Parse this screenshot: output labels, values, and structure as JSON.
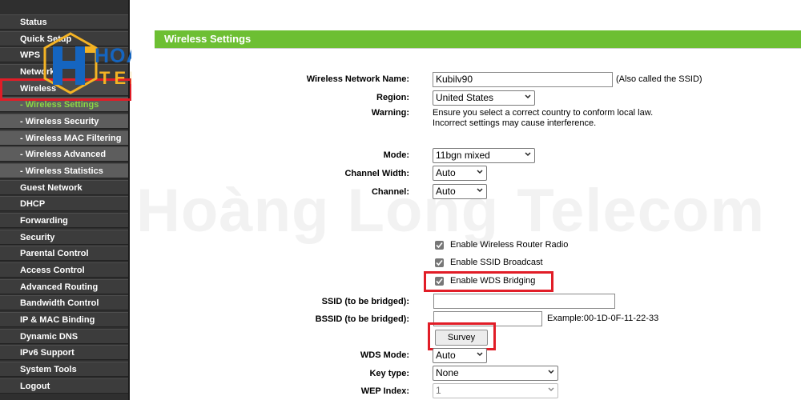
{
  "sidebar": {
    "items": [
      {
        "label": "Status"
      },
      {
        "label": "Quick Setup"
      },
      {
        "label": "WPS"
      },
      {
        "label": "Network"
      },
      {
        "label": "Wireless"
      },
      {
        "label": "- Wireless Settings"
      },
      {
        "label": "- Wireless Security"
      },
      {
        "label": "- Wireless MAC Filtering"
      },
      {
        "label": "- Wireless Advanced"
      },
      {
        "label": "- Wireless Statistics"
      },
      {
        "label": "Guest Network"
      },
      {
        "label": "DHCP"
      },
      {
        "label": "Forwarding"
      },
      {
        "label": "Security"
      },
      {
        "label": "Parental Control"
      },
      {
        "label": "Access Control"
      },
      {
        "label": "Advanced Routing"
      },
      {
        "label": "Bandwidth Control"
      },
      {
        "label": "IP & MAC Binding"
      },
      {
        "label": "Dynamic DNS"
      },
      {
        "label": "IPv6 Support"
      },
      {
        "label": "System Tools"
      },
      {
        "label": "Logout"
      }
    ]
  },
  "logo": {
    "line1": "HOANG LONG",
    "line2": "TELECOM"
  },
  "watermark": "Hoàng Long Telecom",
  "page": {
    "title": "Wireless Settings"
  },
  "form": {
    "network_name_label": "Wireless Network Name:",
    "network_name_value": "Kubilv90",
    "network_name_hint": "(Also called the SSID)",
    "region_label": "Region:",
    "region_value": "United States",
    "warning_label": "Warning:",
    "warning_line1": "Ensure you select a correct country to conform local law.",
    "warning_line2": "Incorrect settings may cause interference.",
    "mode_label": "Mode:",
    "mode_value": "11bgn mixed",
    "channel_width_label": "Channel Width:",
    "channel_width_value": "Auto",
    "channel_label": "Channel:",
    "channel_value": "Auto",
    "enable_radio_label": "Enable Wireless Router Radio",
    "enable_ssid_broadcast_label": "Enable SSID Broadcast",
    "enable_wds_label": "Enable WDS Bridging",
    "ssid_bridged_label": "SSID (to be bridged):",
    "ssid_bridged_value": "",
    "bssid_bridged_label": "BSSID (to be bridged):",
    "bssid_bridged_value": "",
    "bssid_example": "Example:00-1D-0F-11-22-33",
    "survey_label": "Survey",
    "wds_mode_label": "WDS Mode:",
    "wds_mode_value": "Auto",
    "key_type_label": "Key type:",
    "key_type_value": "None",
    "wep_index_label": "WEP Index:",
    "wep_index_value": "1"
  },
  "colors": {
    "accent_green": "#6dbf33",
    "highlight_red": "#e11d27",
    "logo_blue": "#1565c0",
    "logo_gold": "#f4b324"
  }
}
